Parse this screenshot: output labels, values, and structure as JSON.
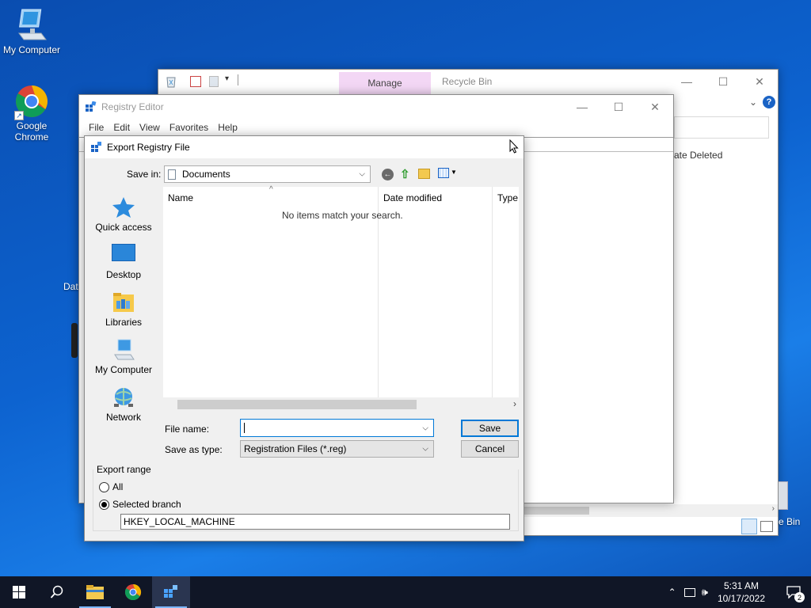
{
  "desktop": {
    "icons": [
      {
        "label": "My Computer"
      },
      {
        "label": "Google\nChrome"
      }
    ],
    "partial_labels": [
      "Dat",
      "e Bin"
    ]
  },
  "recycle_bin": {
    "title": "Recycle Bin",
    "manage_tab": "Manage",
    "column_date_deleted": "ate Deleted"
  },
  "regedit": {
    "title": "Registry Editor",
    "menu": [
      "File",
      "Edit",
      "View",
      "Favorites",
      "Help"
    ]
  },
  "dialog": {
    "title": "Export Registry File",
    "save_in_label": "Save in:",
    "save_in_value": "Documents",
    "places": [
      "Quick access",
      "Desktop",
      "Libraries",
      "My Computer",
      "Network"
    ],
    "columns": [
      "Name",
      "Date modified",
      "Type"
    ],
    "empty_message": "No items match your search.",
    "file_name_label": "File name:",
    "file_name_value": "",
    "save_as_type_label": "Save as type:",
    "save_as_type_value": "Registration Files (*.reg)",
    "save_button": "Save",
    "cancel_button": "Cancel",
    "export_range_label": "Export range",
    "radio_all": "All",
    "radio_selected": "Selected branch",
    "selected_branch_value": "HKEY_LOCAL_MACHINE"
  },
  "taskbar": {
    "clock_time": "5:31 AM",
    "clock_date": "10/17/2022",
    "notification_count": "2"
  },
  "colors": {
    "accent": "#0078d7",
    "desktop_blue": "#0d63d0",
    "manage_tab": "#f3d7f5",
    "taskbar": "#101626"
  }
}
